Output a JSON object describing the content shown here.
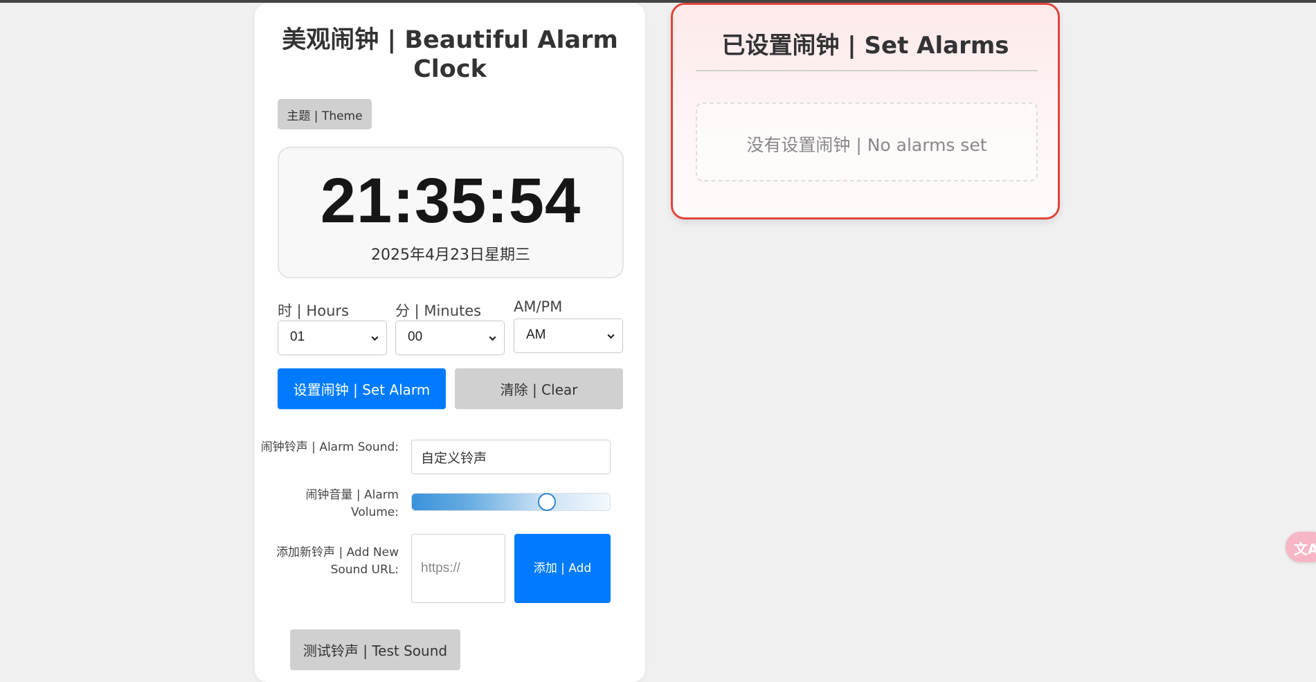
{
  "app": {
    "title": "美观闹钟 | Beautiful Alarm Clock",
    "theme_button": "主题 | Theme"
  },
  "clock": {
    "time": "21:35:54",
    "date": "2025年4月23日星期三"
  },
  "alarm_form": {
    "hours_label": "时 | Hours",
    "hours_value": "01",
    "minutes_label": "分 | Minutes",
    "minutes_value": "00",
    "ampm_label": "AM/PM",
    "ampm_value": "AM",
    "set_button": "设置闹钟 | Set Alarm",
    "clear_button": "清除 | Clear"
  },
  "sound_settings": {
    "sound_label": "闹钟铃声 | Alarm Sound:",
    "sound_value": "自定义铃声",
    "volume_label": "闹钟音量 | Alarm Volume:",
    "volume_fraction": 0.68,
    "new_sound_label": "添加新铃声 | Add New Sound URL:",
    "new_sound_placeholder": "https://",
    "add_button": "添加 | Add",
    "test_button": "测试铃声 | Test Sound"
  },
  "alarms_panel": {
    "title": "已设置闹钟 | Set Alarms",
    "empty_message": "没有设置闹钟 | No alarms set"
  },
  "theme_colors": {
    "primary": "#007bff",
    "alarm_border": "#e0443a",
    "secondary_button": "#d0d0d0"
  },
  "icons": {
    "select_chevron": "chevron-down-icon",
    "translate_widget": "translate-icon"
  }
}
